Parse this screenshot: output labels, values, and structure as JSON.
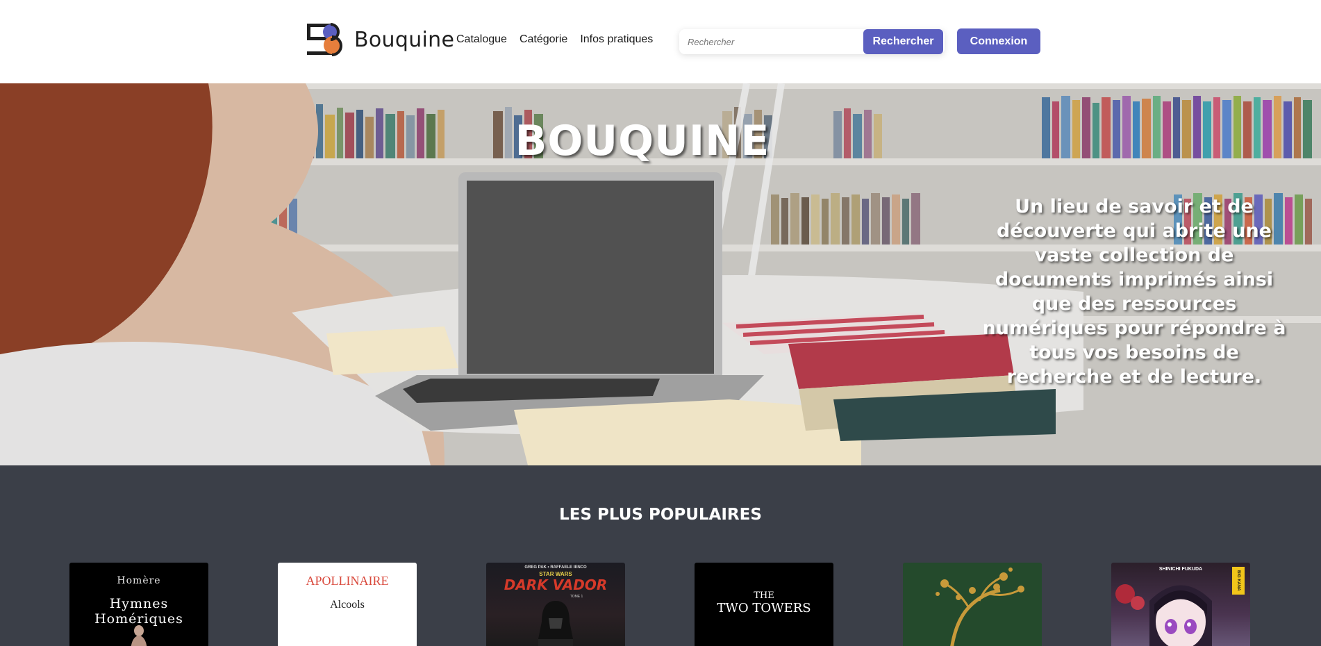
{
  "header": {
    "brand": "Bouquine",
    "nav": [
      "Catalogue",
      "Catégorie",
      "Infos pratiques"
    ],
    "search_placeholder": "Rechercher",
    "search_button": "Rechercher",
    "login_button": "Connexion"
  },
  "hero": {
    "title": "BOUQUINE",
    "description": "Un lieu de savoir et de découverte qui abrite une vaste collection de documents imprimés ainsi que des ressources numériques pour répondre à tous vos besoins de recherche et de lecture."
  },
  "popular": {
    "title": "LES PLUS POPULAIRES",
    "books": [
      {
        "line1": "Homère",
        "line2": "Hymnes Homériques"
      },
      {
        "line1": "APOLLINAIRE",
        "line2": "Alcools"
      },
      {
        "line1": "GREG PAK • RAFFAELE IENCO",
        "line2": "STAR WARS",
        "line3": "DARK VADOR",
        "line4": "TOME 1"
      },
      {
        "line1": "THE",
        "line2": "TWO TOWERS"
      },
      {},
      {
        "line1": "SHINICHI FUKUDA",
        "line2": "BIG KANA"
      }
    ]
  },
  "colors": {
    "accent": "#5b5fc0",
    "popular_bg": "#3b3f48"
  }
}
